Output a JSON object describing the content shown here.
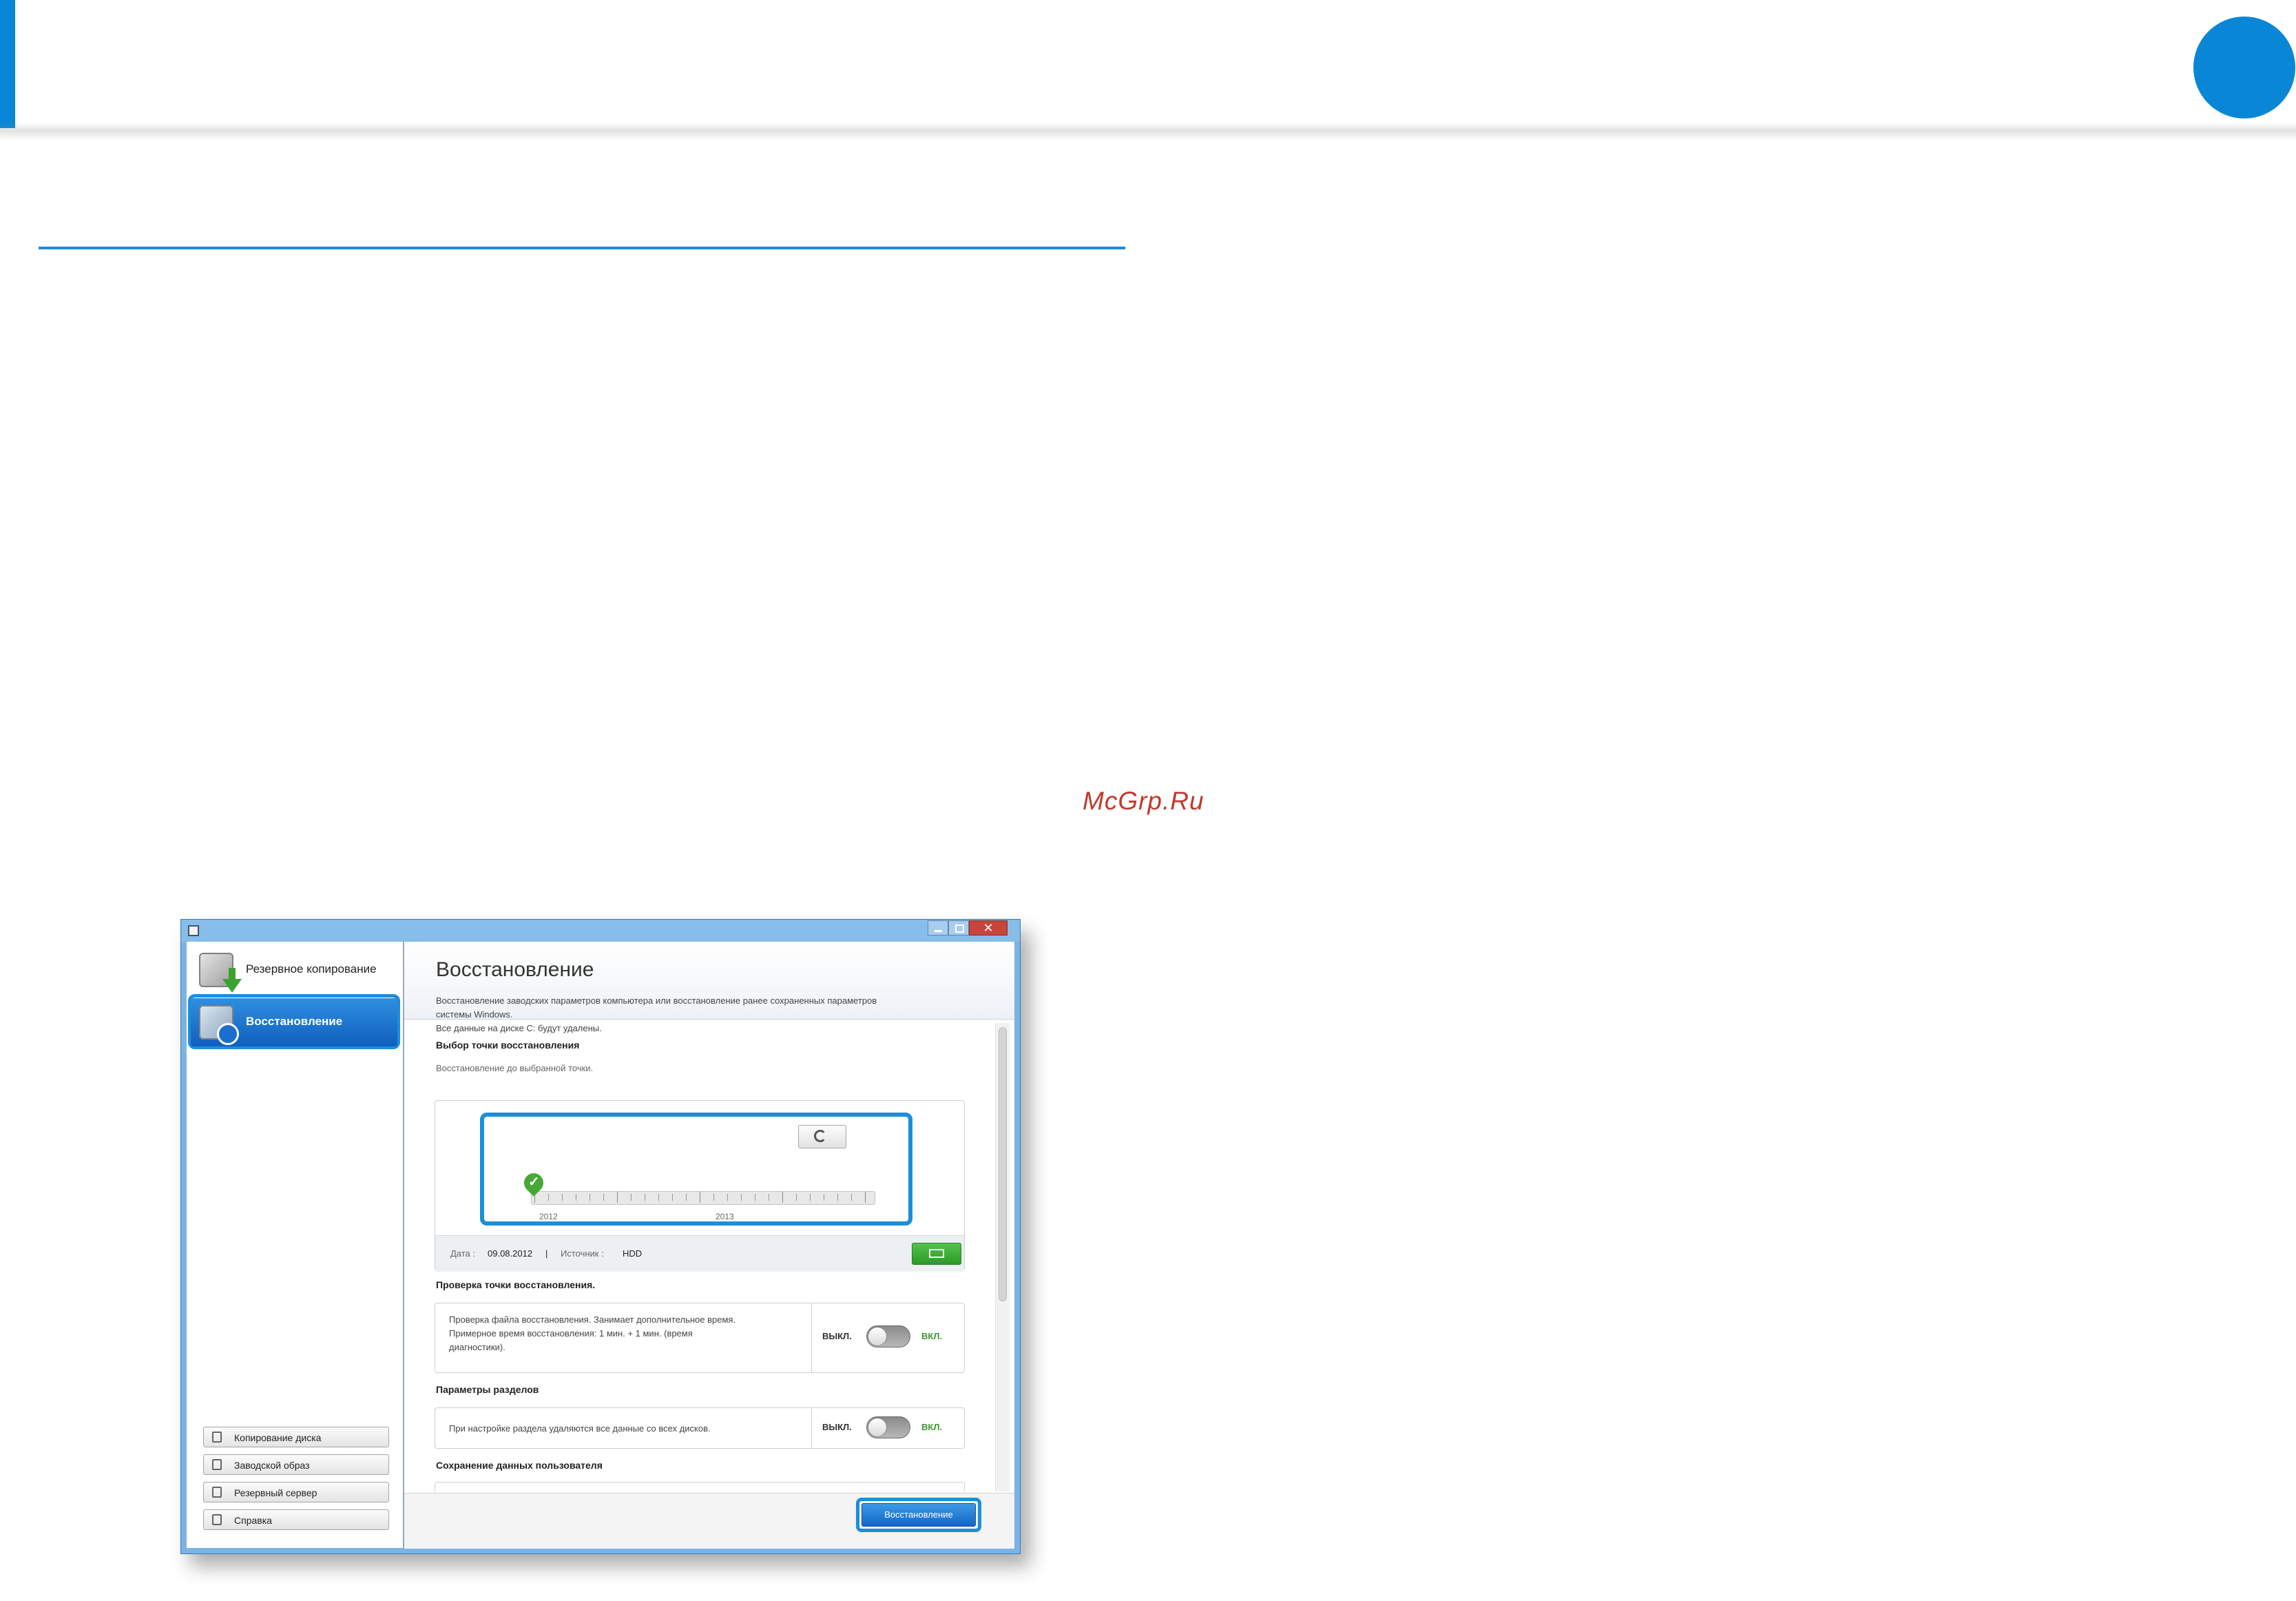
{
  "watermark": "McGrp.Ru",
  "colors": {
    "accent": "#0a86d6",
    "green": "#3a9a2f"
  },
  "sidebar": {
    "items": [
      {
        "label": "Резервное копирование",
        "icon": "backup-icon"
      },
      {
        "label": "Восстановление",
        "icon": "restore-icon",
        "selected": true
      }
    ],
    "buttons": [
      {
        "label": "Копирование диска",
        "icon": "disk-copy-icon"
      },
      {
        "label": "Заводской образ",
        "icon": "factory-image-icon"
      },
      {
        "label": "Резервный сервер",
        "icon": "backup-server-icon"
      },
      {
        "label": "Справка",
        "icon": "help-icon"
      }
    ]
  },
  "main": {
    "title": "Восстановление",
    "description": [
      "Восстановление заводских параметров компьютера или восстановление ранее сохраненных параметров",
      "системы Windows.",
      "Все данные на диске C: будут удалены."
    ],
    "restore_point": {
      "title": "Выбор точки восстановления",
      "subtitle": "Восстановление до выбранной точки.",
      "years": [
        "2012",
        "2013"
      ],
      "date_label": "Дата :",
      "date_value": "09.08.2012",
      "separator": "|",
      "source_label": "Источник :",
      "source_value": "HDD"
    },
    "check": {
      "title": "Проверка точки восстановления.",
      "desc": [
        "Проверка файла восстановления. Занимает дополнительное время.",
        "Примерное время восстановления: 1 мин. + 1 мин. (время",
        "диагностики)."
      ],
      "off_label": "ВЫКЛ.",
      "on_label": "ВКЛ.",
      "state": "off"
    },
    "partitions": {
      "title": "Параметры разделов",
      "desc": "При настройке раздела удаляются все данные со всех дисков.",
      "off_label": "ВЫКЛ.",
      "on_label": "ВКЛ.",
      "state": "off"
    },
    "user_data": {
      "title": "Сохранение данных пользователя"
    },
    "restore_button": "Восстановление"
  }
}
